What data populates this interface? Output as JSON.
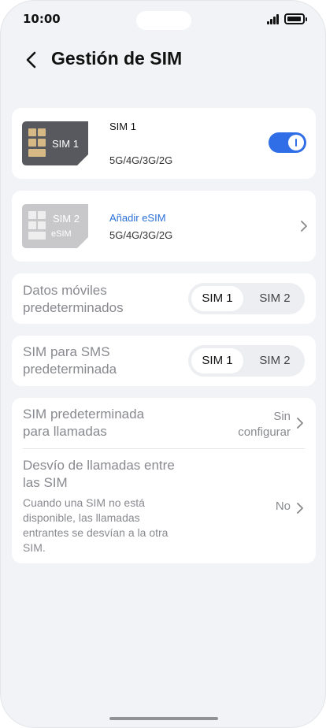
{
  "status_bar": {
    "time": "10:00"
  },
  "header": {
    "title": "Gestión de SIM"
  },
  "sim1": {
    "card_label": "SIM 1",
    "name": "SIM 1",
    "networks": "5G/4G/3G/2G",
    "enabled": true
  },
  "sim2": {
    "card_label": "SIM 2",
    "card_sub": "eSIM",
    "action": "Añadir eSIM",
    "networks": "5G/4G/3G/2G"
  },
  "mobile_data": {
    "label_line1": "Datos móviles",
    "label_line2": "predeterminados",
    "options": [
      "SIM 1",
      "SIM 2"
    ],
    "selected": "SIM 1"
  },
  "sms": {
    "label_line1": "SIM para SMS",
    "label_line2": "predeterminada",
    "options": [
      "SIM 1",
      "SIM 2"
    ],
    "selected": "SIM 1"
  },
  "calls": {
    "label_line1": "SIM predeterminada",
    "label_line2": "para llamadas",
    "value_line1": "Sin",
    "value_line2": "configurar"
  },
  "call_forwarding": {
    "title_line1": "Desvío de llamadas entre",
    "title_line2": "las SIM",
    "desc_line1": "Cuando una SIM no está",
    "desc_line2": "disponible, las llamadas",
    "desc_line3": "entrantes se desvían a la otra",
    "desc_line4": "SIM.",
    "value": "No"
  },
  "colors": {
    "accent": "#2f6ee6",
    "link": "#2a6fd6",
    "background": "#f1f3f6",
    "sim1_card": "#5b5b62",
    "sim2_card": "#c9c9cc"
  }
}
